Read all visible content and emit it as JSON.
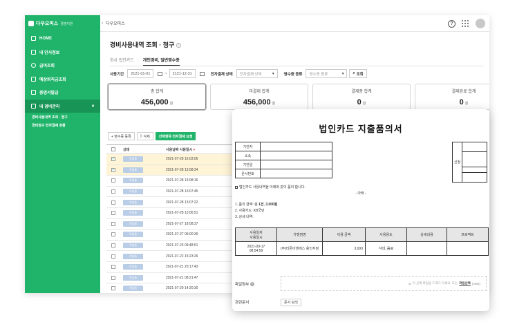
{
  "sidebar": {
    "logo": "다우오피스",
    "logo_sub": "경영지원",
    "items": [
      {
        "label": "HOME"
      },
      {
        "label": "내 인사정보"
      },
      {
        "label": "급여조회"
      },
      {
        "label": "예상퇴직금조회"
      },
      {
        "label": "증명서발급"
      },
      {
        "label": "내 경비관리"
      }
    ],
    "chevron": "∨",
    "sub_items": [
      {
        "label": "경비사용내역 조회 · 청구"
      },
      {
        "label": "경비청구 전자결재 현황"
      }
    ]
  },
  "topbar": {
    "collapse": "‹",
    "breadcrumb": "다우오피스",
    "help": "?"
  },
  "page": {
    "title": "경비사용내역 조회 · 청구",
    "info": "i",
    "tabs": [
      {
        "label": "회사 법인카드"
      },
      {
        "label": "개인경비, 일반영수증"
      }
    ]
  },
  "filters": {
    "period_label": "사용기간",
    "date_from": "2121-01-01",
    "tilde": "~",
    "date_to": "2121-12-31",
    "approval_label": "전자결재 상태",
    "approval_placeholder": "전자결재 상태",
    "receipt_label": "영수증 종류",
    "receipt_placeholder": "영수증 종류",
    "caret": "▾",
    "search_label": "조회"
  },
  "cards": [
    {
      "label": "총 합계",
      "value": "456,000",
      "unit": "원"
    },
    {
      "label": "미결재 합계",
      "value": "456,000",
      "unit": "원"
    },
    {
      "label": "결재중 합계",
      "value": "0",
      "unit": "원"
    },
    {
      "label": "결재완료 합계",
      "value": "0",
      "unit": "원"
    }
  ],
  "actions": {
    "add": "+ 영수증 등록",
    "delete": "삭제",
    "approve": "선택항목 전자결재 요청"
  },
  "table": {
    "headers": {
      "status": "상태",
      "date": "사용날짜 사용일시",
      "sort": "▾"
    },
    "status_badge": "작성중",
    "check_mark": "✓",
    "rows": [
      {
        "date": "2021-07-28 16:03:06",
        "checked": true
      },
      {
        "date": "2021-07-28 13:08:34",
        "checked": true
      },
      {
        "date": "2021-07-28 13:08:16",
        "checked": false
      },
      {
        "date": "2021-07-28 13:07:45",
        "checked": false
      },
      {
        "date": "2021-07-28 13:07:22",
        "checked": false
      },
      {
        "date": "2021-07-28 13:06:51",
        "checked": false
      },
      {
        "date": "2021-07-27 18:08:37",
        "checked": false
      },
      {
        "date": "2021-07-27 09:00:39",
        "checked": false
      },
      {
        "date": "2021-07-23 09:48:51",
        "checked": false
      },
      {
        "date": "2021-07-22 15:23:26",
        "checked": false
      },
      {
        "date": "2021-07-21 20:17:43",
        "checked": false
      },
      {
        "date": "2021-07-21 08:21:47",
        "checked": false
      },
      {
        "date": "2021-07-20 14:20:30",
        "checked": false
      }
    ]
  },
  "document": {
    "title": "법인카드 지출품의서",
    "info_rows": [
      {
        "label": "기안자"
      },
      {
        "label": "소속"
      },
      {
        "label": "기안일"
      },
      {
        "label": "문서번호"
      }
    ],
    "sign_label": "신청",
    "agree_text": "법인카드 사용내역을 아래와 같이 품의 합니다.",
    "below": "- 아래 -",
    "line1_prefix": "1. 품의 금액: 총 ",
    "line1_count": "1건",
    "line1_amount": "3,000원",
    "line2": "2. 사용카드: KB국민",
    "line3": "3. 상세 내역:",
    "detail_headers": [
      "사용일자\n사용일시",
      "가맹점명",
      "이용 금액",
      "사용용도",
      "상세내용",
      "프로젝트"
    ],
    "detail_row": {
      "date": "2021-09-17\n08:54:59",
      "merchant": "(주)티몬이엔에스 용인지점",
      "amount": "3,000",
      "purpose": "식대, 음료"
    },
    "attach_label": "파일첨부",
    "attach_hint": "이 곳에 파일을 드래그 하세요. 또는",
    "attach_link": "파일선택",
    "attach_limit": "(0MB)",
    "doc_label": "관련문서",
    "doc_button": "문서 검색"
  }
}
